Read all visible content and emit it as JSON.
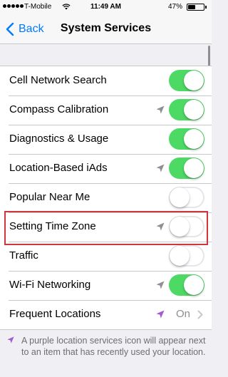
{
  "status_bar": {
    "carrier": "T-Mobile",
    "time": "11:49 AM",
    "battery_percent": "47%",
    "battery_level": 0.47,
    "signal_bars": 5
  },
  "nav": {
    "back_label": "Back",
    "title": "System Services"
  },
  "services": [
    {
      "label": "Cell Network Search",
      "location_icon": false,
      "location_icon_color": null,
      "toggle": true
    },
    {
      "label": "Compass Calibration",
      "location_icon": true,
      "location_icon_color": "#8e8e93",
      "toggle": true
    },
    {
      "label": "Diagnostics & Usage",
      "location_icon": false,
      "location_icon_color": null,
      "toggle": true
    },
    {
      "label": "Location-Based iAds",
      "location_icon": true,
      "location_icon_color": "#8e8e93",
      "toggle": true
    },
    {
      "label": "Popular Near Me",
      "location_icon": false,
      "location_icon_color": null,
      "toggle": false
    },
    {
      "label": "Setting Time Zone",
      "location_icon": true,
      "location_icon_color": "#8e8e93",
      "toggle": false,
      "highlighted": true
    },
    {
      "label": "Traffic",
      "location_icon": false,
      "location_icon_color": null,
      "toggle": false
    },
    {
      "label": "Wi-Fi Networking",
      "location_icon": true,
      "location_icon_color": "#8e8e93",
      "toggle": true
    },
    {
      "label": "Frequent Locations",
      "location_icon": true,
      "location_icon_color": "#a259d9",
      "value": "On",
      "disclosure": true
    }
  ],
  "footer": {
    "text": "A purple location services icon will appear next to an item that has recently used your location.",
    "icon_color": "#a259d9"
  },
  "colors": {
    "accent": "#007aff",
    "toggle_on": "#4cd964",
    "highlight": "#d0343d",
    "recent_location": "#a259d9"
  }
}
